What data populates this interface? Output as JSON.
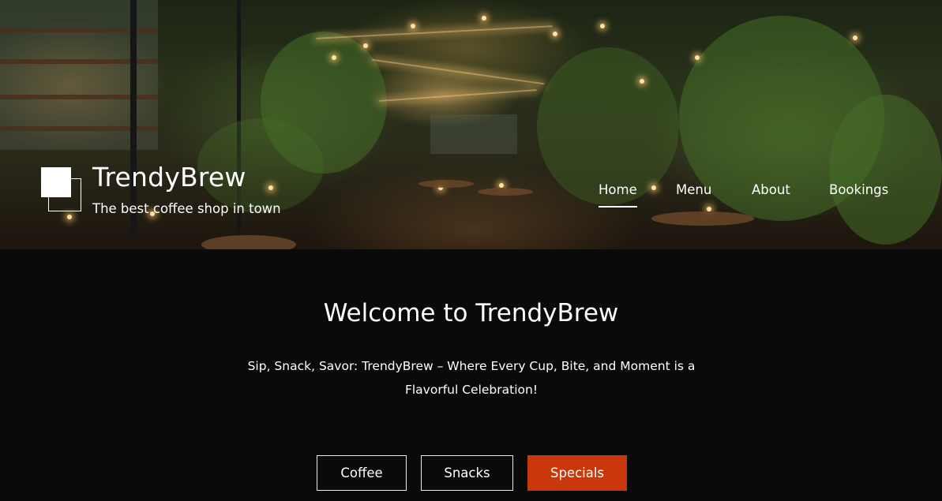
{
  "brand": {
    "title": "TrendyBrew",
    "tagline": "The best coffee shop in town"
  },
  "nav": {
    "items": [
      {
        "label": "Home",
        "active": true
      },
      {
        "label": "Menu",
        "active": false
      },
      {
        "label": "About",
        "active": false
      },
      {
        "label": "Bookings",
        "active": false
      }
    ]
  },
  "main": {
    "heading": "Welcome to TrendyBrew",
    "subtitle": "Sip, Snack, Savor: TrendyBrew – Where Every Cup, Bite, and Moment is a Flavorful Celebration!",
    "buttons": [
      {
        "label": "Coffee",
        "style": "outline"
      },
      {
        "label": "Snacks",
        "style": "outline"
      },
      {
        "label": "Specials",
        "style": "filled"
      }
    ]
  },
  "colors": {
    "accent": "#c9380a",
    "background": "#0a0a0a",
    "text": "#ffffff"
  },
  "hero_image": "night-cafe-garden-with-string-lights"
}
